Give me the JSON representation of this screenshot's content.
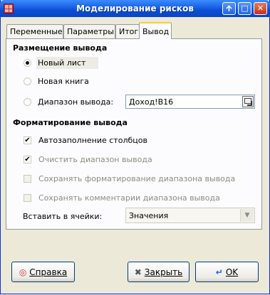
{
  "window": {
    "title": "Моделирование рисков",
    "buttons": {
      "minimize": "🡩",
      "maximize": "□",
      "close": "✕"
    }
  },
  "tabs": [
    {
      "label": "Переменные",
      "active": false
    },
    {
      "label": "Параметры",
      "active": false
    },
    {
      "label": "Итог",
      "active": false
    },
    {
      "label": "Вывод",
      "active": true
    }
  ],
  "output_placement": {
    "heading": "Размещение вывода",
    "options": [
      {
        "label": "Новый лист",
        "selected": true
      },
      {
        "label": "Новая книга",
        "selected": false
      },
      {
        "label": "Диапазон вывода:",
        "selected": false
      }
    ],
    "range_value": "Доход!B16"
  },
  "output_format": {
    "heading": "Форматирование вывода",
    "checks": [
      {
        "label": "Автозаполнение столбцов",
        "checked": true,
        "enabled": true
      },
      {
        "label": "Очистить диапазон вывода",
        "checked": true,
        "enabled": false
      },
      {
        "label": "Сохранять форматирование диапазона вывода",
        "checked": false,
        "enabled": false
      },
      {
        "label": "Сохранять комментарии диапазона вывода",
        "checked": false,
        "enabled": false
      }
    ],
    "paste_label": "Вставить в ячейки:",
    "paste_value": "Значения"
  },
  "footer": {
    "help": "Справка",
    "close": "Закрыть",
    "ok": "OK"
  },
  "colors": {
    "titlebar": "#0a4fd4",
    "accent_tab": "#ffc83c",
    "face": "#ece9d8"
  }
}
